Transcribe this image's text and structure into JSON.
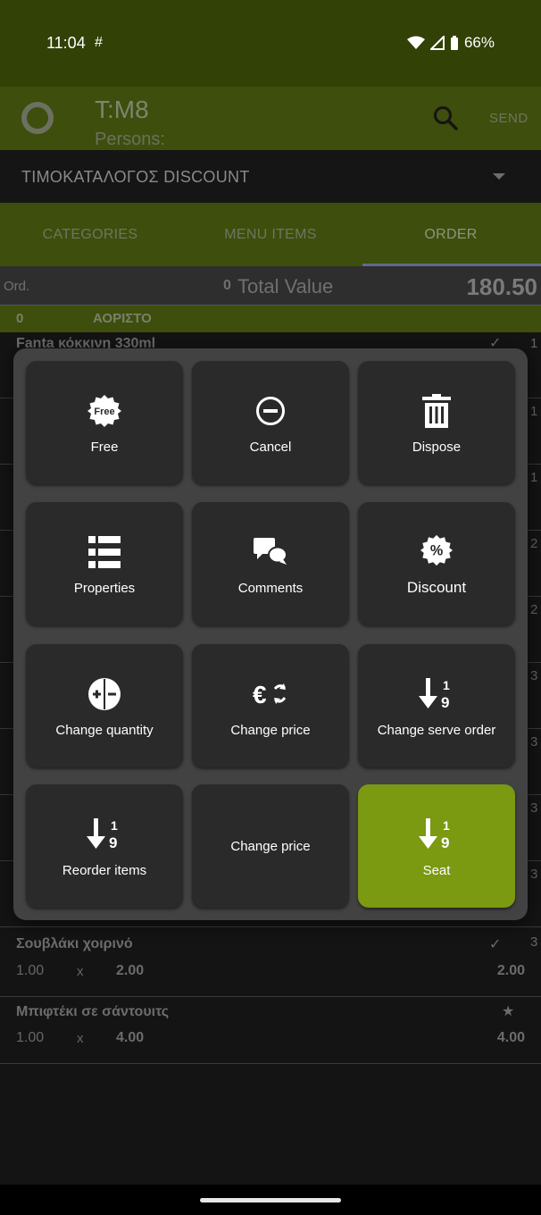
{
  "status_bar": {
    "time": "11:04",
    "battery": "66%"
  },
  "app_bar": {
    "title": "T:M8",
    "subtitle": "Persons:",
    "send_label": "SEND"
  },
  "price_list": {
    "selected": "ΤΙΜΟΚΑΤΑΛΟΓΟΣ DISCOUNT"
  },
  "tabs": [
    {
      "label": "CATEGORIES"
    },
    {
      "label": "MENU ITEMS"
    },
    {
      "label": "ORDER",
      "active": true
    }
  ],
  "order_summary": {
    "ord_label": "Ord.",
    "count": "0",
    "total_label": "Total Value",
    "total": "180.50"
  },
  "group": {
    "number": "0",
    "name": "ΑΟΡΙΣΤΟ"
  },
  "order_rows": [
    {
      "name": "Fanta κόκκινη 330ml",
      "qty": "",
      "x": "",
      "price": "",
      "total": "",
      "mark": "✓",
      "seat": "1"
    },
    {
      "name": "Σουβλάκι χοιρινό",
      "qty": "1.00",
      "x": "x",
      "price": "2.00",
      "total": "2.00",
      "mark": "✓",
      "seat": "3"
    },
    {
      "name": "Μπιφτέκι σε σάντουιτς",
      "qty": "1.00",
      "x": "x",
      "price": "4.00",
      "total": "4.00",
      "mark": "★",
      "seat": ""
    }
  ],
  "row_seat_markers": [
    "1",
    "1",
    "1",
    "2",
    "2",
    "3",
    "3",
    "3"
  ],
  "actions": [
    {
      "label": "Free",
      "icon": "free-badge-icon",
      "badge_text": "Free"
    },
    {
      "label": "Cancel",
      "icon": "minus-circle-icon"
    },
    {
      "label": "Dispose",
      "icon": "trash-icon"
    },
    {
      "label": "Properties",
      "icon": "list-icon"
    },
    {
      "label": "Comments",
      "icon": "comments-icon"
    },
    {
      "label": "Discount",
      "icon": "percent-badge-icon"
    },
    {
      "label": "Change quantity",
      "icon": "plus-minus-icon"
    },
    {
      "label": "Change price",
      "icon": "euro-exchange-icon"
    },
    {
      "label": "Change serve order",
      "icon": "sort-numeric-icon",
      "digits": [
        "1",
        "9"
      ]
    },
    {
      "label": "Reorder items",
      "icon": "sort-numeric-icon",
      "digits": [
        "1",
        "9"
      ]
    },
    {
      "label": "Change price",
      "icon": ""
    },
    {
      "label": "Seat",
      "icon": "sort-numeric-icon",
      "digits": [
        "1",
        "9"
      ],
      "selected": true
    }
  ],
  "colors": {
    "accent": "#7b9911",
    "tile": "#2a2a2a",
    "modal": "#424242",
    "header": "#3e4e0c"
  }
}
